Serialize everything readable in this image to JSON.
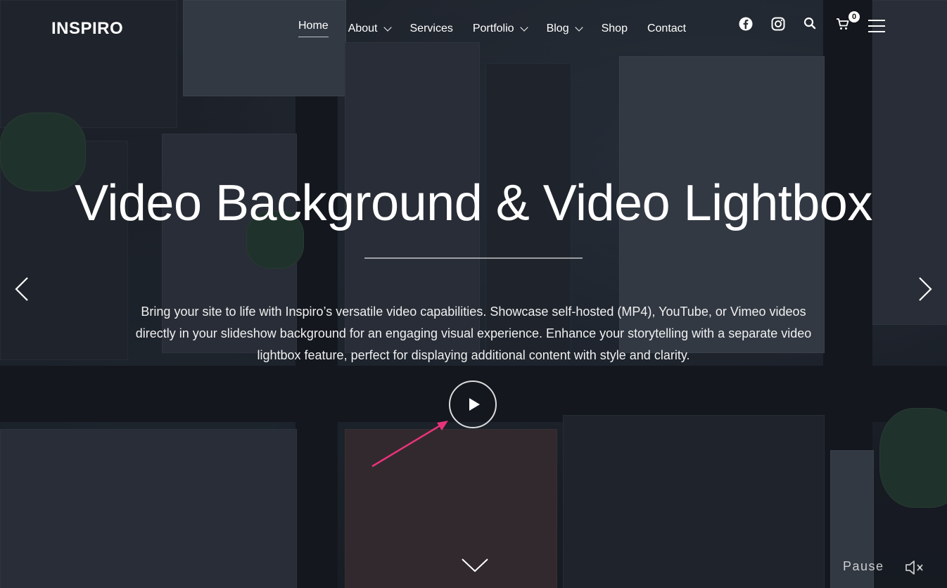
{
  "brand": {
    "logo_text": "INSPIRO"
  },
  "nav": {
    "items": [
      {
        "label": "Home",
        "has_dropdown": false,
        "active": true
      },
      {
        "label": "About",
        "has_dropdown": true,
        "active": false
      },
      {
        "label": "Services",
        "has_dropdown": false,
        "active": false
      },
      {
        "label": "Portfolio",
        "has_dropdown": true,
        "active": false
      },
      {
        "label": "Blog",
        "has_dropdown": true,
        "active": false
      },
      {
        "label": "Shop",
        "has_dropdown": false,
        "active": false
      },
      {
        "label": "Contact",
        "has_dropdown": false,
        "active": false
      }
    ]
  },
  "header_icons": {
    "facebook": "facebook-icon",
    "instagram": "instagram-icon",
    "search": "search-icon",
    "cart": "cart-icon",
    "cart_count": "0",
    "menu": "hamburger-menu-icon"
  },
  "hero": {
    "title": "Video Background & Video Lightbox",
    "description": "Bring your site to life with Inspiro’s versatile video capabilities. Showcase self-hosted (MP4), YouTube, or Vimeo videos directly in your slideshow background for an engaging visual experience. Enhance your storytelling with a separate video lightbox feature, perfect for displaying additional content with style and clarity."
  },
  "controls": {
    "pause_label": "Pause",
    "prev_icon": "chevron-left-icon",
    "next_icon": "chevron-right-icon",
    "play_icon": "play-icon",
    "scroll_icon": "chevron-down-icon",
    "mute_icon": "speaker-muted-icon"
  },
  "colors": {
    "annotation_arrow": "#e8337a",
    "text": "#ffffff"
  }
}
